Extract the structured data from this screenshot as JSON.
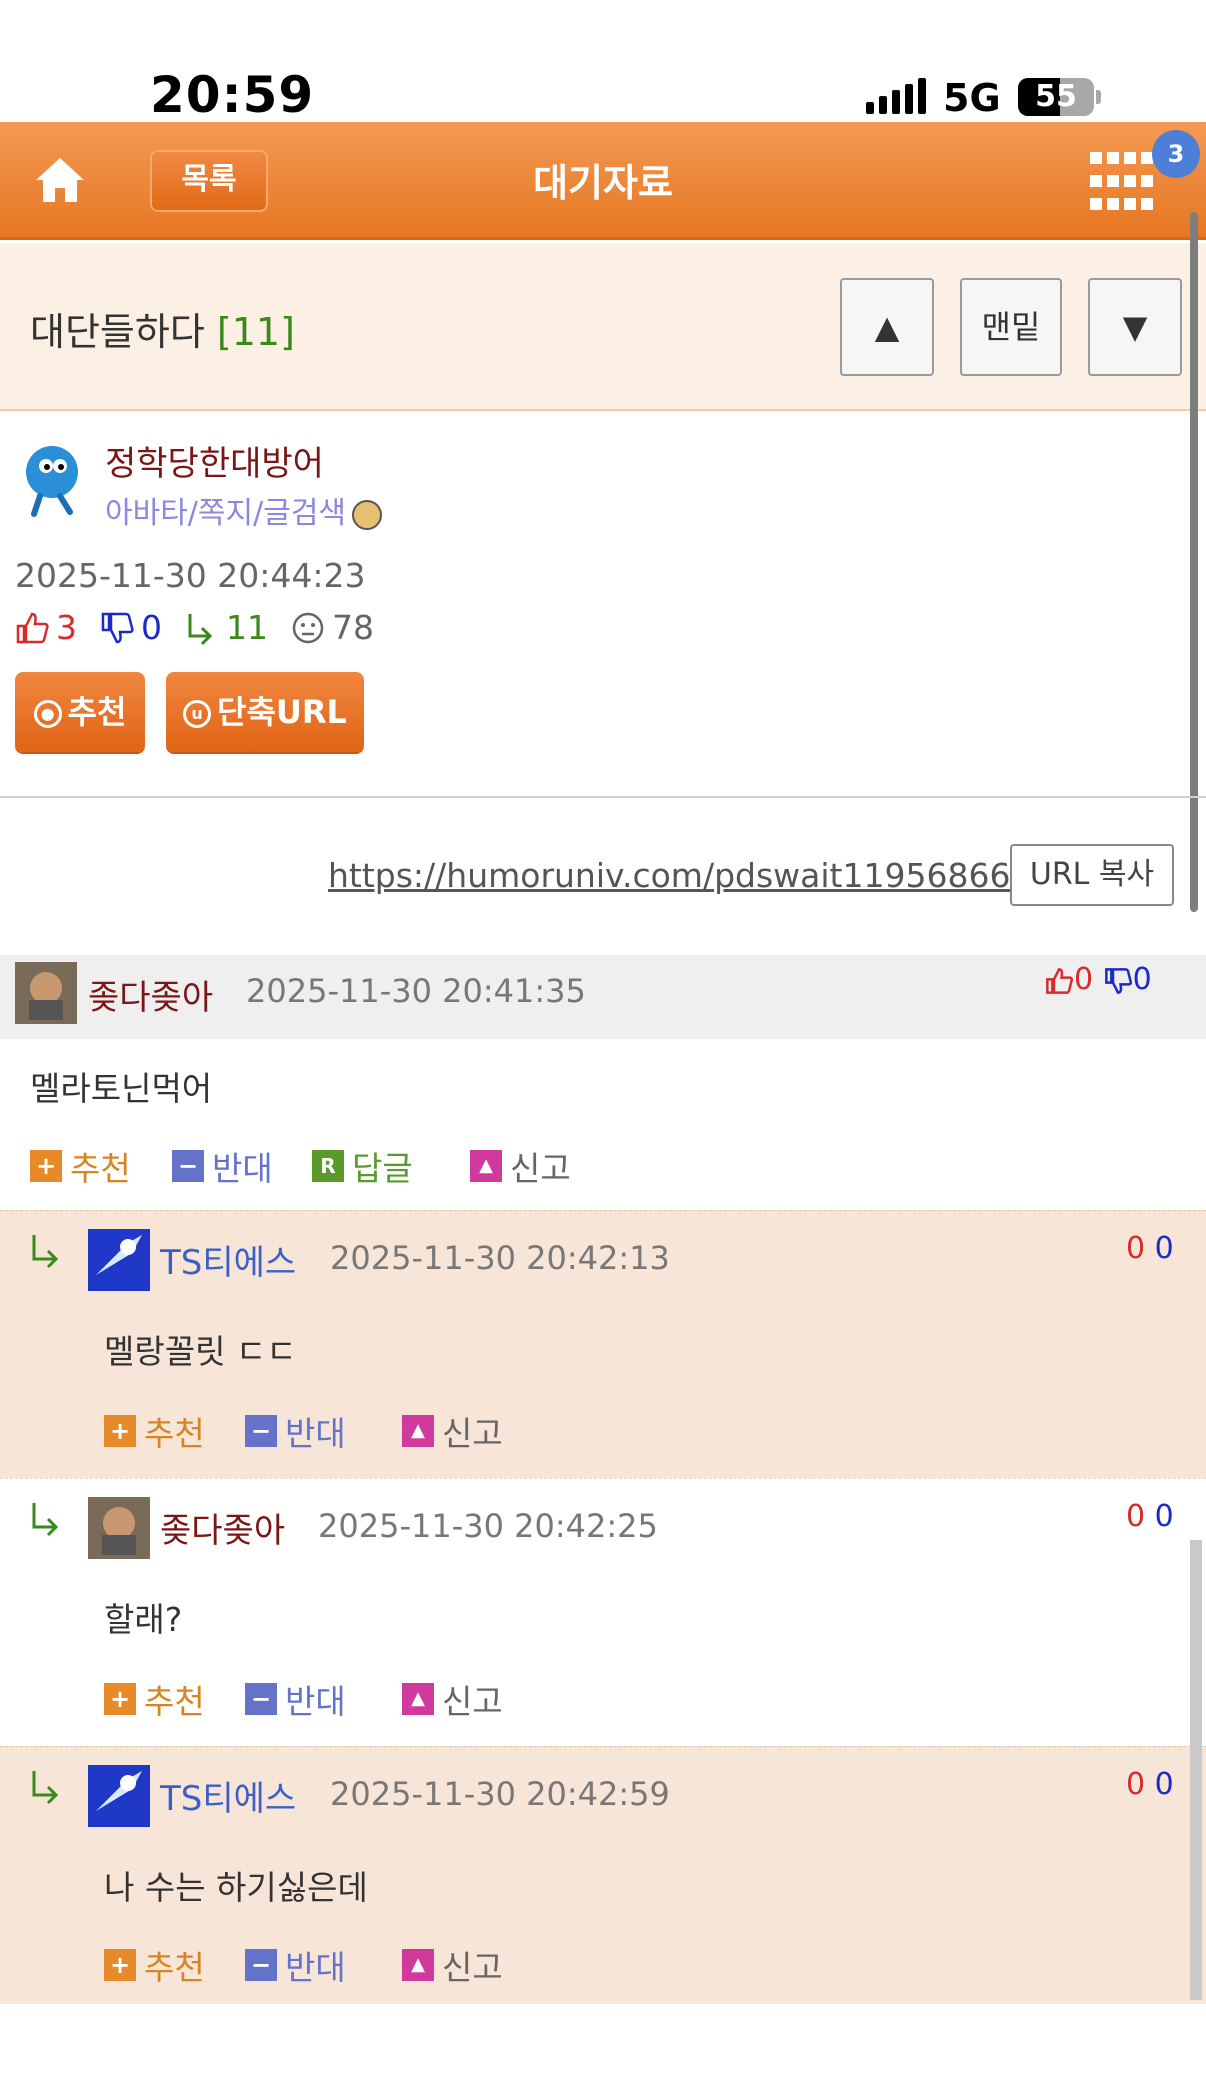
{
  "status_bar": {
    "time": "20:59",
    "network": "5G",
    "battery": "55",
    "battery_level": 0.55
  },
  "app_bar": {
    "list_label": "목록",
    "title": "대기자료",
    "notification_count": "3"
  },
  "post": {
    "title": "대단들하다",
    "comment_count": "[11]",
    "nav_up": "▲",
    "nav_bottom": "맨밑",
    "nav_down": "▼",
    "author": "정학당한대방어",
    "author_links": "아바타/쪽지/글검색",
    "date": "2025-11-30 20:44:23",
    "upvotes": "3",
    "downvotes": "0",
    "replies": "11",
    "views": "78",
    "recommend_label": "추천",
    "short_url_label": "단축URL",
    "short_url": "https://humoruniv.com/pdswait11956866",
    "copy_label": "URL 복사"
  },
  "comments": [
    {
      "name": "좆다좆아",
      "date": "2025-11-30 20:41:35",
      "body": "멜라토닌먹어",
      "up": "0",
      "down": "0"
    },
    {
      "name": "TS티에스",
      "date": "2025-11-30 20:42:13",
      "body": "멜랑꼴릿 ㄷㄷ",
      "up": "0",
      "down": "0"
    },
    {
      "name": "좆다좆아",
      "date": "2025-11-30 20:42:25",
      "body": "할래?",
      "up": "0",
      "down": "0"
    },
    {
      "name": "TS티에스",
      "date": "2025-11-30 20:42:59",
      "body": "나 수는 하기싫은데",
      "up": "0",
      "down": "0"
    }
  ],
  "actions": {
    "recommend": "추천",
    "oppose": "반대",
    "reply": "답글",
    "report": "신고"
  },
  "colors": {
    "accent": "#e67623",
    "up": "#d82b2b",
    "down": "#1a2bc8",
    "reply": "#3a8a1a"
  }
}
